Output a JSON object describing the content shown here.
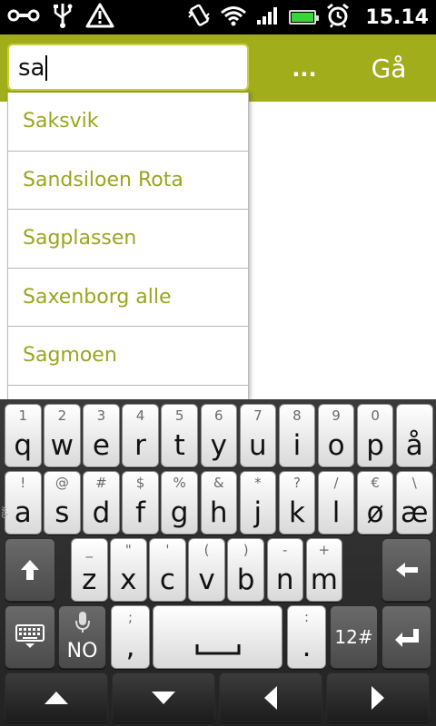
{
  "status_bar": {
    "time": "15.14",
    "icons": [
      "usb-link-icon",
      "usb-icon",
      "warning-icon",
      "vibrate-icon",
      "wifi-icon",
      "signal-icon",
      "battery-icon",
      "alarm-icon"
    ],
    "battery_level_percent": 90,
    "battery_color": "#3bd33b"
  },
  "search": {
    "value": "sa",
    "more_label": "...",
    "go_label": "Gå",
    "accent_color": "#a1ad1b"
  },
  "suggestions": [
    "Saksvik",
    "Sandsiloen Rota",
    "Sagplassen",
    "Saxenborg alle",
    "Sagmoen"
  ],
  "keyboard": {
    "row1": [
      {
        "sub": "1",
        "main": "q"
      },
      {
        "sub": "2",
        "main": "w"
      },
      {
        "sub": "3",
        "main": "e"
      },
      {
        "sub": "4",
        "main": "r"
      },
      {
        "sub": "5",
        "main": "t"
      },
      {
        "sub": "6",
        "main": "y"
      },
      {
        "sub": "7",
        "main": "u"
      },
      {
        "sub": "8",
        "main": "i"
      },
      {
        "sub": "9",
        "main": "o"
      },
      {
        "sub": "0",
        "main": "p"
      },
      {
        "sub": "",
        "main": "å"
      }
    ],
    "row2": [
      {
        "sub": "!",
        "main": "a"
      },
      {
        "sub": "@",
        "main": "s"
      },
      {
        "sub": "#",
        "main": "d"
      },
      {
        "sub": "$",
        "main": "f"
      },
      {
        "sub": "%",
        "main": "g"
      },
      {
        "sub": "&",
        "main": "h"
      },
      {
        "sub": "*",
        "main": "j"
      },
      {
        "sub": "?",
        "main": "k"
      },
      {
        "sub": "/",
        "main": "l"
      },
      {
        "sub": "€",
        "main": "ø"
      },
      {
        "sub": "\\",
        "main": "æ"
      }
    ],
    "row3": [
      {
        "sub": "_",
        "main": "z"
      },
      {
        "sub": "\"",
        "main": "x"
      },
      {
        "sub": "'",
        "main": "c"
      },
      {
        "sub": "(",
        "main": "v"
      },
      {
        "sub": ")",
        "main": "b"
      },
      {
        "sub": "-",
        "main": "n"
      },
      {
        "sub": "+",
        "main": "m"
      }
    ],
    "row4": {
      "comma_sub": ";",
      "comma_main": ",",
      "period_sub": ":",
      "period_main": ".",
      "voice_label": "NO",
      "numbers_label": "12#"
    },
    "side_label": "qw"
  }
}
